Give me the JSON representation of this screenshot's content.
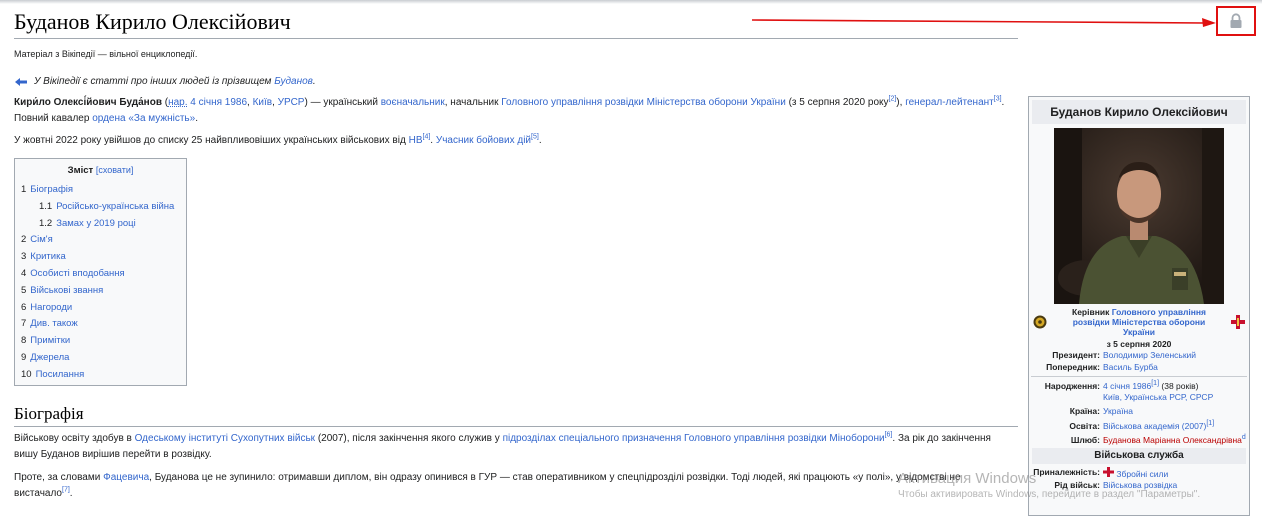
{
  "page": {
    "title": "Буданов Кирило Олексійович",
    "subtitle": "Матеріал з Вікіпедії — вільної енциклопедії."
  },
  "hatnote": {
    "prefix": "У Вікіпедії є статті про інших людей із прізвищем ",
    "link": "Буданов",
    "suffix": "."
  },
  "intro": {
    "p1": [
      {
        "t": "Кири́ло Олексі́йович Буда́нов",
        "s": "b"
      },
      {
        "t": " ("
      },
      {
        "t": "нар.",
        "s": "lu"
      },
      {
        "t": " "
      },
      {
        "t": "4 січня 1986",
        "s": "l"
      },
      {
        "t": ", "
      },
      {
        "t": "Київ",
        "s": "l"
      },
      {
        "t": ", "
      },
      {
        "t": "УРСР",
        "s": "l"
      },
      {
        "t": ") — український "
      },
      {
        "t": "воєначальник",
        "s": "l"
      },
      {
        "t": ", начальник "
      },
      {
        "t": "Головного управління розвідки Міністерства оборони України",
        "s": "l"
      },
      {
        "t": " (з 5 серпня 2020 року"
      },
      {
        "t": "[2]",
        "s": "sup"
      },
      {
        "t": "), "
      },
      {
        "t": "генерал-лейтенант",
        "s": "l"
      },
      {
        "t": "[3]",
        "s": "sup"
      },
      {
        "t": ". Повний кавалер "
      },
      {
        "t": "ордена «За мужність»",
        "s": "l"
      },
      {
        "t": "."
      }
    ],
    "p2": [
      {
        "t": "У жовтні 2022 року увійшов до списку 25 найвпливовіших українських військових від "
      },
      {
        "t": "НВ",
        "s": "l"
      },
      {
        "t": "[4]",
        "s": "sup"
      },
      {
        "t": ". "
      },
      {
        "t": "Учасник бойових дій",
        "s": "l"
      },
      {
        "t": "[5]",
        "s": "sup"
      },
      {
        "t": "."
      }
    ]
  },
  "toc": {
    "title": "Зміст",
    "toggle": "[сховати]",
    "items": [
      {
        "num": "1",
        "label": "Біографія",
        "sub": false
      },
      {
        "num": "1.1",
        "label": "Російсько-українська війна",
        "sub": true
      },
      {
        "num": "1.2",
        "label": "Замах у 2019 році",
        "sub": true
      },
      {
        "num": "2",
        "label": "Сім'я",
        "sub": false
      },
      {
        "num": "3",
        "label": "Критика",
        "sub": false
      },
      {
        "num": "4",
        "label": "Особисті вподобання",
        "sub": false
      },
      {
        "num": "5",
        "label": "Військові звання",
        "sub": false
      },
      {
        "num": "6",
        "label": "Нагороди",
        "sub": false
      },
      {
        "num": "7",
        "label": "Див. також",
        "sub": false
      },
      {
        "num": "8",
        "label": "Примітки",
        "sub": false
      },
      {
        "num": "9",
        "label": "Джерела",
        "sub": false
      },
      {
        "num": "10",
        "label": "Посилання",
        "sub": false
      }
    ]
  },
  "biography": {
    "heading": "Біографія",
    "p1": [
      {
        "t": "Військову освіту здобув в "
      },
      {
        "t": "Одеському інституті Сухопутних військ",
        "s": "l"
      },
      {
        "t": " (2007), після закінчення якого служив у "
      },
      {
        "t": "підрозділах спеціального призначення Головного управління розвідки Міноборони",
        "s": "l"
      },
      {
        "t": "[6]",
        "s": "sup"
      },
      {
        "t": ". За рік до закінчення вишу Буданов вирішив перейти в розвідку."
      }
    ],
    "p2": [
      {
        "t": "Проте, за словами "
      },
      {
        "t": "Фацевича",
        "s": "l"
      },
      {
        "t": ", Буданова це не зупинило: отримавши диплом, він одразу опинився в ГУР — став оперативником у спецпідрозділі розвідки. Тоді людей, які працюють «у полі», у відомстві не вистачало"
      },
      {
        "t": "[7]",
        "s": "sup"
      },
      {
        "t": "."
      }
    ]
  },
  "infobox": {
    "title": "Буданов Кирило Олексійович",
    "office_prefix": "Керівник ",
    "office_link": "Головного управління розвідки Міністерства оборони України",
    "term": "з 5 серпня 2020",
    "president_label": "Президент:",
    "president": "Володимир Зеленський",
    "predecessor_label": "Попередник:",
    "predecessor": "Василь Бурба",
    "birth_label": "Народження:",
    "birth_date": "4 січня 1986",
    "birth_ref": "[1]",
    "birth_age": " (38 років)",
    "birth_place": "Київ, Українська РСР, СРСР",
    "country_label": "Країна:",
    "country": "Україна",
    "education_label": "Освіта:",
    "education": "Військова академія (2007)",
    "education_ref": "[1]",
    "spouse_label": "Шлюб:",
    "spouse": "Буданова Маріанна Олександрівна",
    "spouse_ref": "d",
    "military_header": "Військова служба",
    "allegiance_label": "Приналежність:",
    "allegiance": "Збройні сили",
    "branch_label": "Рід військ:",
    "branch": "Військова розвідка"
  },
  "watermark": {
    "line1": "Активация Windows",
    "line2": "Чтобы активировать Windows, перейдите в раздел \"Параметры\"."
  },
  "colors": {
    "link": "#3366cc",
    "redlink": "#ba0000",
    "annotation": "#e01010"
  }
}
